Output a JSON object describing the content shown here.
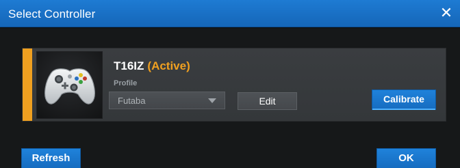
{
  "window": {
    "title": "Select Controller",
    "close_glyph": "✕"
  },
  "controller": {
    "name": "T16IZ",
    "status": "(Active)",
    "profile_label": "Profile",
    "profile_value": "Futaba",
    "thumbnail_icon": "gamepad-icon",
    "active_indicator_color": "#f0a020"
  },
  "buttons": {
    "edit": "Edit",
    "calibrate": "Calibrate",
    "refresh": "Refresh",
    "ok": "OK"
  },
  "colors": {
    "accent_blue": "#1a74cc",
    "active_orange": "#f0a020"
  }
}
